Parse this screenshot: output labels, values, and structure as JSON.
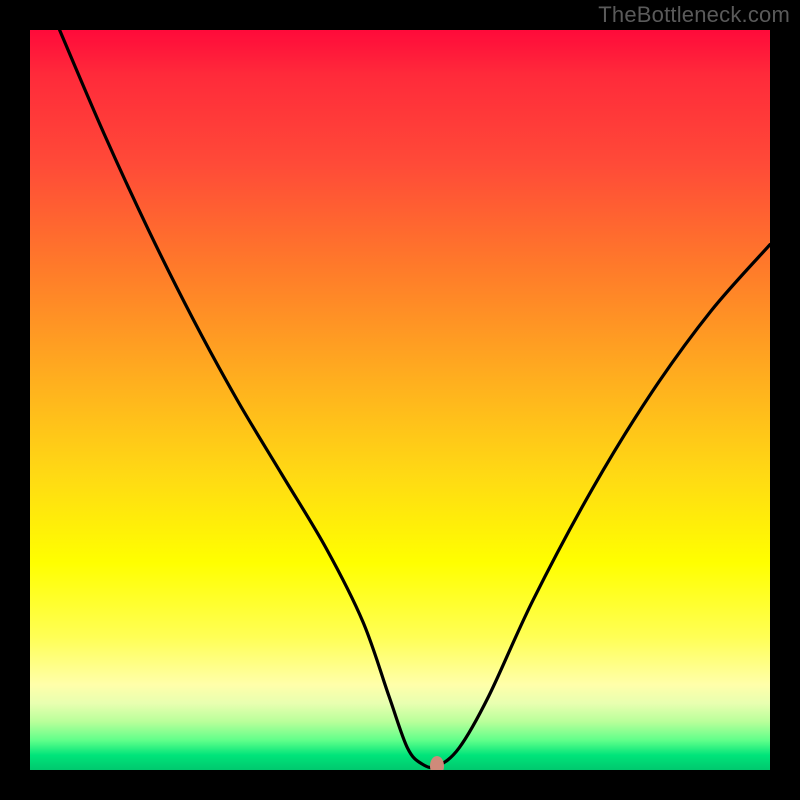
{
  "watermark": "TheBottleneck.com",
  "chart_data": {
    "type": "line",
    "title": "",
    "xlabel": "",
    "ylabel": "",
    "xlim": [
      0,
      100
    ],
    "ylim": [
      0,
      100
    ],
    "grid": false,
    "series": [
      {
        "name": "bottleneck-curve",
        "x": [
          4,
          10,
          16,
          22,
          28,
          34,
          40,
          45,
          48.5,
          51,
          53,
          55,
          58,
          62,
          68,
          76,
          84,
          92,
          100
        ],
        "y": [
          100,
          86,
          73,
          61,
          50,
          40,
          30,
          20,
          10,
          3,
          0.8,
          0.5,
          3,
          10,
          23,
          38,
          51,
          62,
          71
        ]
      }
    ],
    "marker": {
      "name": "optimal-point",
      "x": 55,
      "y": 0.5,
      "color": "#cf8a7a"
    },
    "background_gradient": {
      "stops": [
        {
          "pos": 0.0,
          "color": "#ff0a3a"
        },
        {
          "pos": 0.72,
          "color": "#ffff00"
        },
        {
          "pos": 1.0,
          "color": "#00c86e"
        }
      ]
    }
  }
}
